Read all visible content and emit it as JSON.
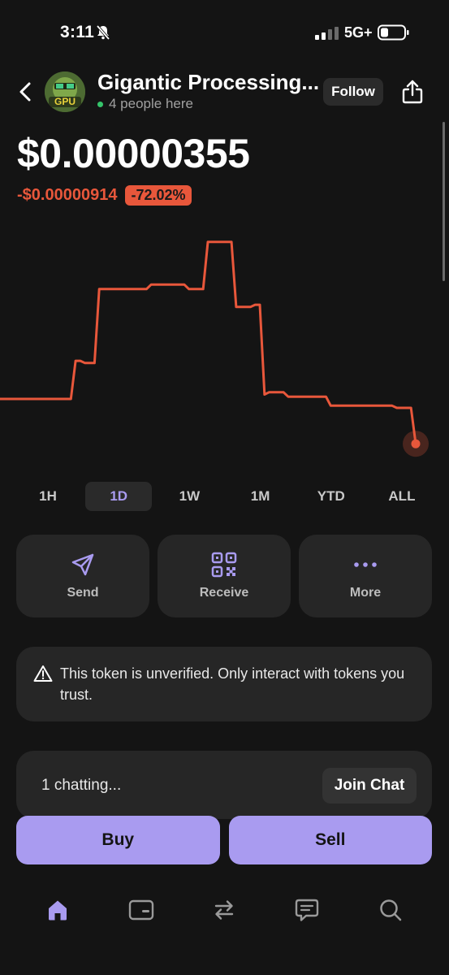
{
  "status_bar": {
    "time": "3:11",
    "network": "5G+",
    "icons": [
      "bell-off-icon",
      "cellular-signal-icon",
      "battery-icon"
    ]
  },
  "header": {
    "token_name": "Gigantic Processing...",
    "avatar_text": "GPU",
    "presence": "4 people here",
    "follow_label": "Follow",
    "icons": [
      "chevron-left-icon",
      "share-icon"
    ]
  },
  "price": {
    "value": "$0.00000355",
    "change_abs": "-$0.00000914",
    "change_pct": "-72.02%"
  },
  "colors": {
    "background": "#141414",
    "card": "#262626",
    "accent": "#a99bf0",
    "negative": "#e8573b",
    "presence_dot": "#35c46a"
  },
  "chart_data": {
    "type": "line",
    "title": "",
    "xlabel": "",
    "ylabel": "",
    "grid": false,
    "ylim": [
      0,
      1
    ],
    "series": [
      {
        "values": [
          0.25,
          0.25,
          0.25,
          0.25,
          0.25,
          0.25,
          0.25,
          0.25,
          0.25,
          0.25,
          0.25,
          0.25,
          0.25,
          0.25,
          0.25,
          0.25,
          0.42,
          0.42,
          0.41,
          0.41,
          0.41,
          0.74,
          0.74,
          0.74,
          0.74,
          0.74,
          0.74,
          0.74,
          0.74,
          0.74,
          0.74,
          0.74,
          0.76,
          0.76,
          0.76,
          0.76,
          0.76,
          0.76,
          0.76,
          0.76,
          0.74,
          0.74,
          0.74,
          0.74,
          0.95,
          0.95,
          0.95,
          0.95,
          0.95,
          0.95,
          0.66,
          0.66,
          0.66,
          0.66,
          0.67,
          0.67,
          0.27,
          0.28,
          0.28,
          0.28,
          0.28,
          0.26,
          0.26,
          0.26,
          0.26,
          0.26,
          0.26,
          0.26,
          0.26,
          0.26,
          0.22,
          0.22,
          0.22,
          0.22,
          0.22,
          0.22,
          0.22,
          0.22,
          0.22,
          0.22,
          0.22,
          0.22,
          0.22,
          0.22,
          0.21,
          0.21,
          0.21,
          0.21,
          0.05
        ]
      }
    ]
  },
  "ranges": [
    {
      "label": "1H",
      "active": false
    },
    {
      "label": "1D",
      "active": true
    },
    {
      "label": "1W",
      "active": false
    },
    {
      "label": "1M",
      "active": false
    },
    {
      "label": "YTD",
      "active": false
    },
    {
      "label": "ALL",
      "active": false
    }
  ],
  "actions": [
    {
      "label": "Send",
      "icon": "send-icon"
    },
    {
      "label": "Receive",
      "icon": "qr-code-icon"
    },
    {
      "label": "More",
      "icon": "more-dots-icon"
    }
  ],
  "warning": {
    "icon": "warning-triangle-icon",
    "text": "This token is unverified. Only interact with tokens you trust."
  },
  "chat": {
    "count_text": "1 chatting...",
    "join_label": "Join Chat"
  },
  "trade": {
    "buy_label": "Buy",
    "sell_label": "Sell"
  },
  "tabbar": [
    {
      "name": "home",
      "icon": "home-icon",
      "active": true
    },
    {
      "name": "wallet",
      "icon": "wallet-card-icon",
      "active": false
    },
    {
      "name": "swap",
      "icon": "swap-arrows-icon",
      "active": false
    },
    {
      "name": "messages",
      "icon": "chat-bubble-icon",
      "active": false
    },
    {
      "name": "search",
      "icon": "search-icon",
      "active": false
    }
  ]
}
